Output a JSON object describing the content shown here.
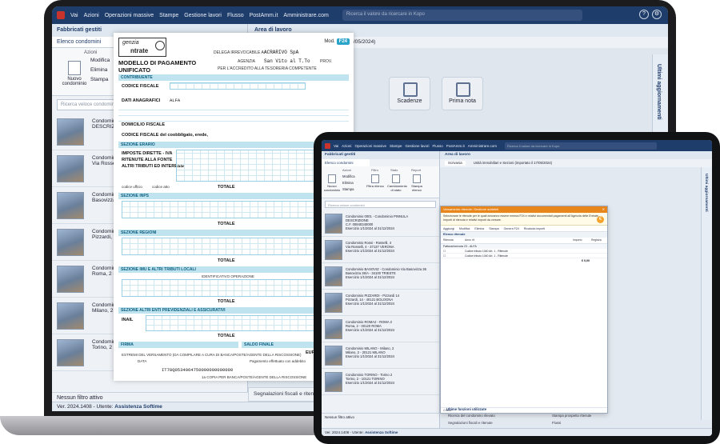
{
  "laptop": {
    "menu": [
      "Vai",
      "Azioni",
      "Operazioni massive",
      "Stampe",
      "Gestione lavori",
      "Flusso",
      "PostAmm.it",
      "Amministrare.com"
    ],
    "search_placeholder": "Ricerca il valore da ricercare in Kopo",
    "left_title": "Fabbricati gestiti",
    "left_tab": "Elenco condomini",
    "toolbar_group": "Azioni",
    "btn_nuovo": "Nuovo condominio",
    "btn_modifica": "Modifica",
    "btn_elimina": "Elimina",
    "btn_stampa": "Stampa",
    "search_list": "Ricerca veloce condomini",
    "rows": [
      {
        "l1": "Condominio",
        "l2": "DESCRIZIONE"
      },
      {
        "l1": "Condominio",
        "l2": "Via Rossel"
      },
      {
        "l1": "Condominio",
        "l2": "Basovizza 3"
      },
      {
        "l1": "Condominio",
        "l2": "Pizzardi, 14"
      },
      {
        "l1": "Condominio",
        "l2": "Roma, 2 - 00"
      },
      {
        "l1": "Condominio",
        "l2": "Milano, 2 - 0"
      },
      {
        "l1": "Condominio",
        "l2": "Torino, 2 - 00"
      }
    ],
    "filter": "Nessun filtro attivo",
    "status_ver": "Ver. 2024.1408 - Utente:",
    "status_user": "Assistenza Softime",
    "main_title": "Area di lavoro",
    "main_tab": "il 17/05/2024)",
    "tile_scadenze": "Scadenze",
    "tile_primanota": "Prima nota",
    "side_label": "Ultimi aggiornamenti",
    "signal": "Segnalazioni fiscali e ritenute"
  },
  "f24": {
    "agenzia_a": "genzia",
    "agenzia_b": "ntrate",
    "title1": "MODELLO DI PAGAMENTO",
    "title2": "UNIFICATO",
    "mod_label": "Mod.",
    "mod_badge": "F24",
    "delega_label": "DELEGA IRREVOCABILE A:",
    "delega_value": "ACRARIVO SpA",
    "agenzia_label": "AGENZIA",
    "agenzia_value": "San Vito al T.To",
    "prov_label": "PROV.",
    "accredito": "PER L'ACCREDITO ALLA TESORERIA COMPETENTE",
    "contribuente": "CONTRIBUENTE",
    "codice_fiscale": "CODICE FISCALE",
    "dati_anagrafici": "DATI ANAGRAFICI",
    "anagrafica_value": "ALFA",
    "domicilio": "DOMICILIO FISCALE",
    "cf_coobbligato": "CODICE FISCALE del coobbligato, erede,",
    "sezione_erario": "SEZIONE ERARIO",
    "imposte": "IMPOSTE DIRETTE - IVA",
    "ritenute": "RITENUTE ALLA FONTE",
    "altri": "ALTRI TRIBUTI ED INTERESSI",
    "codice_ufficio": "codice ufficio",
    "codice_atto": "codice atto",
    "totale": "TOTALE",
    "sezione_inps": "SEZIONE INPS",
    "sezione_regioni": "SEZIONE REGIONI",
    "sezione_imu": "SEZIONE IMU E ALTRI TRIBUTI LOCALI",
    "identificativo": "IDENTIFICATIVO OPERAZIONE",
    "sezione_altri": "SEZIONE ALTRI ENTI PREVIDENZIALI E ASSICURATIVI",
    "inail": "INAIL",
    "firma": "FIRMA",
    "saldo_finale": "SALDO FINALE",
    "euro": "EURO",
    "estremi": "ESTREMI DEL VERSAMENTO (DA COMPILARE A CURA DI BANCA/POSTE/AGENTE DELLA RISCOSSIONE)",
    "data": "DATA",
    "pagamento": "Pagamento effettuato con addebito",
    "iban_value": "IT78Q0534064750000000000000",
    "copia": "1a COPIA PER BANCA/POSTE/AGENTE DELLA RISCOSSIONE"
  },
  "tablet": {
    "menu": [
      "Vai",
      "Azioni",
      "Operazioni massive",
      "Stampe",
      "Gestione lavori",
      "Flusso",
      "PostAmm.it",
      "Amministrare.com"
    ],
    "search_placeholder": "Ricerca il valore da ricercare in Kopo",
    "left_title": "Fabbricati gestiti",
    "left_tab": "Elenco condomini",
    "g_azioni": "Azioni",
    "g_filtro": "Filtro",
    "g_stato": "Stato",
    "g_report": "Report",
    "btn_nuovo": "Nuovo condominio",
    "btn_filtra": "Filtra elenco",
    "btn_cambiamento": "Cambiamento di stato",
    "btn_stampa_elenco": "Stampa elenco",
    "sm_modifica": "Modifica",
    "sm_elimina": "Elimina",
    "sm_stampa": "Stampa",
    "search_list": "Ricerca veloce condomini",
    "rows": [
      {
        "l1": "Condominio 0001 - Condominio PINNULA",
        "l2": "DESCRIZIONE",
        "l3": "C.F. 00840340000",
        "l4": "Esercizio 1/1/2024 al 31/12/2024"
      },
      {
        "l1": "Condominio Rossi - Rosselli, 4",
        "l2": "Via Rosselli, 4 - 37137 VERONA",
        "l3": "Esercizio 1/1/2024 al 31/12/2024",
        "l4": ""
      },
      {
        "l1": "Condominio BASOVIZ - Condominio Via Basovizza 36",
        "l2": "Basovizza 36/A - 34100 TRIESTE",
        "l3": "Esercizio 1/1/2024 al 31/12/2024",
        "l4": ""
      },
      {
        "l1": "Condominio PIZZARDI - Pizzardi 14",
        "l2": "Pizzardi, 14 - 40121 BOLOGNA",
        "l3": "Esercizio 1/1/2024 al 31/12/2024",
        "l4": ""
      },
      {
        "l1": "Condominio ROMA2 - ROMA 2",
        "l2": "Roma, 2 - 00120 ROMA",
        "l3": "Esercizio 1/1/2024 al 31/12/2024",
        "l4": ""
      },
      {
        "l1": "Condominio MILANO - Milano, 2",
        "l2": "Milano, 2 - 20121 MILANO",
        "l3": "Esercizio 1/1/2024 al 31/12/2024",
        "l4": ""
      },
      {
        "l1": "Condominio TORINO - Torino 2",
        "l2": "Torino, 2 - 10121 TORINO",
        "l3": "Esercizio 1/1/2024 al 31/12/2024",
        "l4": ""
      }
    ],
    "filter": "Nessun filtro attivo",
    "status_ver": "Ver. 2024.1408 - Utente:",
    "status_user": "Assistenza Softime",
    "main_title": "Area di lavoro",
    "tab_scrivania": "Scrivania",
    "tab_unita": "Unità immobiliari e Sezioni (importato il 17/05/2024)",
    "side_label": "Ultimi aggiornamenti",
    "dialog_title": "Versamento ritenute: Gestione addebiti",
    "dialog_info": "Selezionare le ritenute per le quali dovranno essere emessi F24 e relativi documentati pagamenti all'Agenzia delle Entrate. Importi di ritenuta e relativi importi da versare.",
    "dialog_tb": [
      "Aggiungi",
      "Modifica",
      "Elimina",
      "Stampa",
      "Genera F24",
      "Ricalcola importi"
    ],
    "dialog_section": "Elenco ritenute",
    "col_ritenuta": "Ritenuta",
    "col_anno": "Anno rif.",
    "col_importo": "Importo",
    "col_registra": "Registra",
    "group_label": "Fattura/ricevuta 23 - ALFA",
    "line1": "Codice tributo 1040 Art. 1 - Ritenute",
    "line2": "Codice tributo 1040 Art. 1 - Ritenute",
    "total": "€ 0,00",
    "dialog_footer": "Chiudi",
    "util_title": "Ultime funzioni utilizzate",
    "util_items": [
      "Ricerca del condomino rilevato",
      "Stampa prospetto ritenute",
      "Segnalazioni fiscali e ritenute",
      "Flussi"
    ]
  }
}
